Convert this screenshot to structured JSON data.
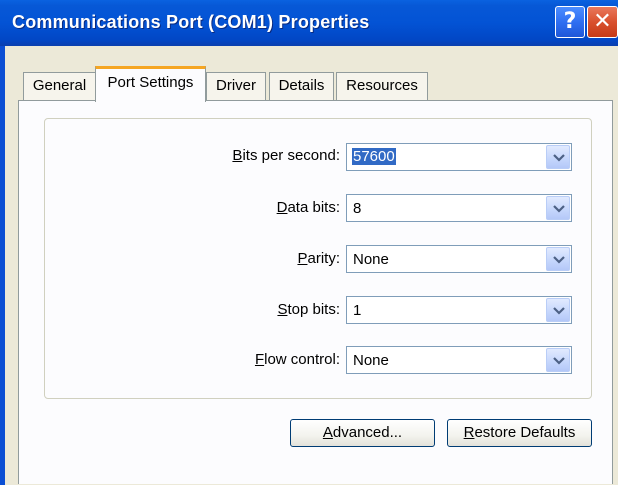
{
  "window": {
    "title": "Communications Port (COM1) Properties",
    "help_button": "?",
    "close_button": "✕"
  },
  "tabs": [
    {
      "label": "General"
    },
    {
      "label": "Port Settings"
    },
    {
      "label": "Driver"
    },
    {
      "label": "Details"
    },
    {
      "label": "Resources"
    }
  ],
  "active_tab": "Port Settings",
  "fields": {
    "bits_per_second": {
      "mnemonic": "B",
      "label_rest": "its per second:",
      "value": "57600"
    },
    "data_bits": {
      "mnemonic": "D",
      "label_rest": "ata bits:",
      "value": "8"
    },
    "parity": {
      "prefix": "",
      "mnemonic": "P",
      "label_rest": "arity:",
      "value": "None"
    },
    "stop_bits": {
      "mnemonic": "S",
      "label_rest": "top bits:",
      "value": "1"
    },
    "flow_control": {
      "mnemonic": "F",
      "label_rest": "low control:",
      "value": "None"
    }
  },
  "buttons": {
    "advanced": {
      "mnemonic": "A",
      "label_rest": "dvanced..."
    },
    "restore_defaults": {
      "mnemonic": "R",
      "label_rest": "estore Defaults"
    }
  },
  "colors": {
    "title_bar": "#0353d5",
    "dialog_bg": "#ece9d8",
    "selection": "#316ac5",
    "active_tab_accent": "#f5a623"
  }
}
